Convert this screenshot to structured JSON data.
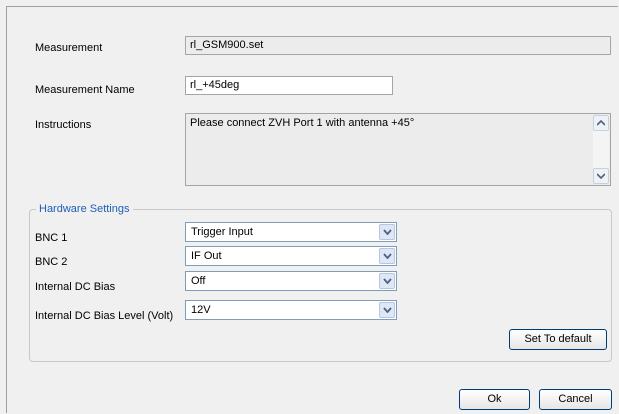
{
  "measurement": {
    "label": "Measurement",
    "value": "rl_GSM900.set"
  },
  "measurement_name": {
    "label": "Measurement Name",
    "value": "rl_+45deg"
  },
  "instructions": {
    "label": "Instructions",
    "value": "Please connect ZVH Port 1 with antenna +45°"
  },
  "hardware": {
    "title": "Hardware Settings",
    "bnc1": {
      "label": "BNC 1",
      "value": "Trigger Input"
    },
    "bnc2": {
      "label": "BNC 2",
      "value": "IF Out"
    },
    "dc_bias": {
      "label": "Internal DC Bias",
      "value": "Off"
    },
    "dc_bias_level": {
      "label": "Internal DC Bias Level (Volt)",
      "value": "12V"
    },
    "set_default_label": "Set To default"
  },
  "buttons": {
    "ok": "Ok",
    "cancel": "Cancel"
  },
  "colors": {
    "group_title": "#1c5fb8",
    "button_border": "#003c74",
    "combo_border": "#7f9db9"
  }
}
